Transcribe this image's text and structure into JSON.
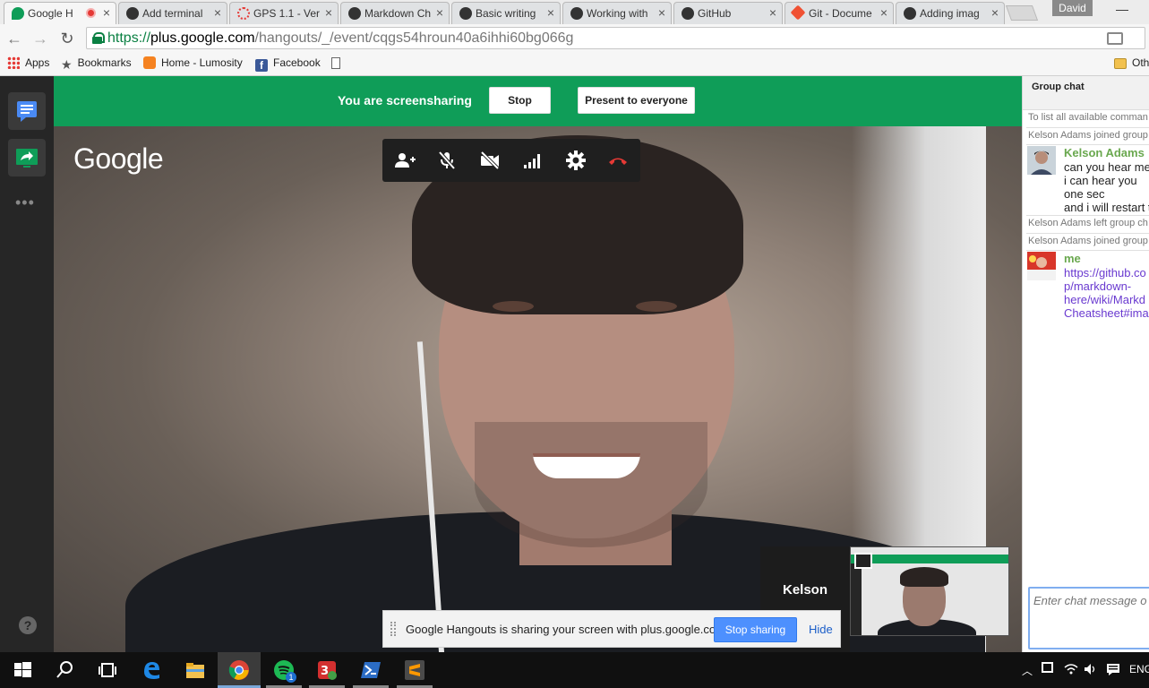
{
  "browser": {
    "tabs": [
      {
        "title": "Google H",
        "favicon": "hangouts-icon",
        "active": true,
        "recording": true
      },
      {
        "title": "Add terminal",
        "favicon": "github-icon"
      },
      {
        "title": "GPS 1.1 - Ver",
        "favicon": "loading-icon"
      },
      {
        "title": "Markdown Ch",
        "favicon": "github-icon"
      },
      {
        "title": "Basic writing",
        "favicon": "github-icon"
      },
      {
        "title": "Working with",
        "favicon": "github-icon"
      },
      {
        "title": "GitHub",
        "favicon": "github-icon"
      },
      {
        "title": "Git - Docume",
        "favicon": "git-icon"
      },
      {
        "title": "Adding imag",
        "favicon": "github-icon"
      }
    ],
    "tab_close": "×",
    "profile_name": "David",
    "minimize": "—",
    "url": {
      "scheme": "https://",
      "host": "plus.google.com",
      "path": "/hangouts/_/event/cqgs54hroun40a6ihhi60bg066g"
    },
    "nav": {
      "back": "←",
      "forward": "→",
      "reload": "↻"
    },
    "bookmarks": [
      {
        "label": "Apps",
        "icon": "apps-grid-icon"
      },
      {
        "label": "Bookmarks",
        "icon": "star-icon"
      },
      {
        "label": "Home - Lumosity",
        "icon": "lumosity-icon"
      },
      {
        "label": "Facebook",
        "icon": "facebook-icon"
      },
      {
        "label": "",
        "icon": "page-icon"
      }
    ],
    "other_bookmarks": "Oth"
  },
  "hangout": {
    "banner_text": "You are screensharing",
    "stop_label": "Stop",
    "present_label": "Present to everyone",
    "logo": "Google",
    "rail_more": "•••",
    "help": "?",
    "participant_name": "Kelson",
    "notice_text": "Google Hangouts is sharing your screen with plus.google.com.",
    "stop_sharing_label": "Stop sharing",
    "hide_label": "Hide",
    "colors": {
      "banner": "#0f9d58",
      "rail": "#262626",
      "hangup": "#e53935"
    }
  },
  "chat": {
    "title": "Group chat",
    "messages": {
      "help_hint": "To list all available comman",
      "join1": "Kelson Adams joined group",
      "sender1": "Kelson Adams",
      "lines1": [
        "can you hear me",
        "i can hear you",
        "one sec",
        "and i will restart t"
      ],
      "left1": "Kelson Adams left group ch",
      "join2": "Kelson Adams joined group",
      "sender2": "me",
      "link_lines": [
        "https://github.co",
        "p/markdown-",
        "here/wiki/Markd",
        "Cheatsheet#ima"
      ]
    },
    "input_placeholder": "Enter chat message o"
  },
  "taskbar": {
    "language": "ENG",
    "spotify_badge": "1"
  }
}
